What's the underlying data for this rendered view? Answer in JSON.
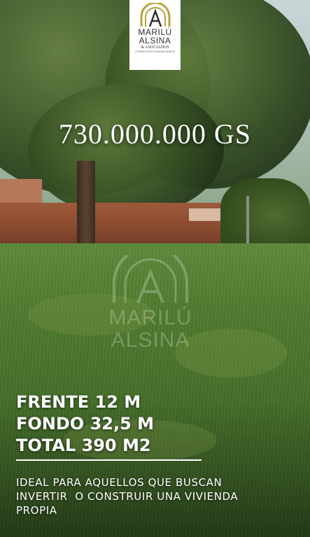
{
  "logo": {
    "line1": "MARILÚ",
    "line2": "ALSINA",
    "line3": "& ASOCIADOS",
    "tagline": "CORREDORES INMOBILIARIOS",
    "mark_color": "#b8a23c"
  },
  "price": "730.000.000 GS",
  "watermark": {
    "line1": "MARILÚ",
    "line2": "ALSINA"
  },
  "specs": {
    "frente": "FRENTE 12 M",
    "fondo": "FONDO 32,5 M",
    "total": "TOTAL 390 M2"
  },
  "description": {
    "line1": "IDEAL PARA AQUELLOS QUE BUSCAN",
    "line2": "INVERTIR  O CONSTRUIR UNA VIVIENDA",
    "line3": "PROPIA"
  }
}
